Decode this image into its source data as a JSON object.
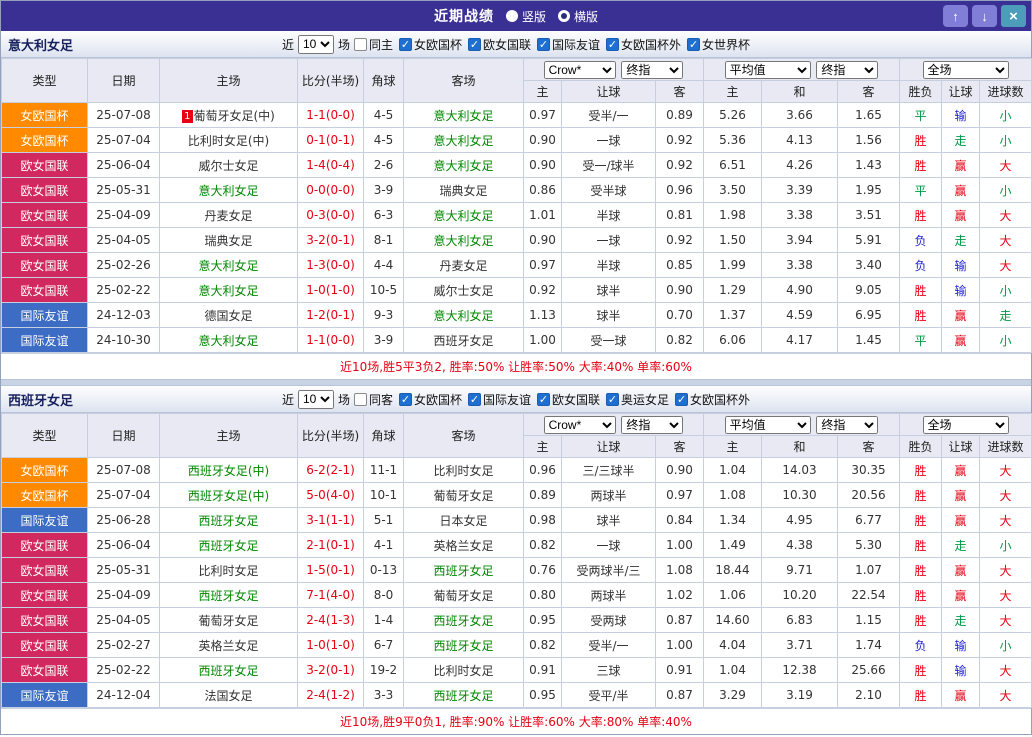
{
  "titlebar": {
    "title": "近期战绩",
    "radios": [
      {
        "label": "竖版",
        "selected": false
      },
      {
        "label": "横版",
        "selected": true
      }
    ],
    "up_icon": "↑",
    "down_icon": "↓",
    "close_icon": "×"
  },
  "colors": {
    "header_bg": "#3a3093",
    "type_orange": "#ff8a00",
    "type_pink": "#d0285f",
    "type_blue": "#3c6cc3",
    "team_green": "#008800",
    "score_red": "#e60012",
    "res_red": "#e60012",
    "res_green": "#009944",
    "res_blue": "#1f1fd0"
  },
  "columns": {
    "left": [
      "类型",
      "日期",
      "主场",
      "比分(半场)",
      "角球",
      "客场"
    ],
    "odds1": [
      "主",
      "让球",
      "客"
    ],
    "odds2": [
      "主",
      "和",
      "客"
    ],
    "result": [
      "胜负",
      "让球",
      "进球数"
    ],
    "selects": {
      "company": "Crow*",
      "final": "终指",
      "average": "平均值",
      "scope": "全场"
    }
  },
  "sections": [
    {
      "team": "意大利女足",
      "filter": {
        "prefix": "近",
        "count": "10",
        "suffix": "场",
        "checkboxes": [
          {
            "label": "同主",
            "checked": false
          },
          {
            "label": "女欧国杯",
            "checked": true
          },
          {
            "label": "欧女国联",
            "checked": true
          },
          {
            "label": "国际友谊",
            "checked": true
          },
          {
            "label": "女欧国杯外",
            "checked": true
          },
          {
            "label": "女世界杯",
            "checked": true
          }
        ]
      },
      "rows": [
        {
          "type": "女欧国杯",
          "date": "25-07-08",
          "home": "葡萄牙女足(中)",
          "home_marker": "1",
          "score": "1-1(0-0)",
          "corner": "4-5",
          "away": "意大利女足",
          "away_green": true,
          "o1": [
            "0.97",
            "受半/一",
            "0.89"
          ],
          "o2": [
            "5.26",
            "3.66",
            "1.65"
          ],
          "res": [
            [
              "平",
              "g"
            ],
            [
              "输",
              "b"
            ],
            [
              "小",
              "g"
            ]
          ]
        },
        {
          "type": "女欧国杯",
          "date": "25-07-04",
          "home": "比利时女足(中)",
          "score": "0-1(0-1)",
          "corner": "4-5",
          "away": "意大利女足",
          "away_green": true,
          "o1": [
            "0.90",
            "一球",
            "0.92"
          ],
          "o2": [
            "5.36",
            "4.13",
            "1.56"
          ],
          "res": [
            [
              "胜",
              "r"
            ],
            [
              "走",
              "g"
            ],
            [
              "小",
              "g"
            ]
          ]
        },
        {
          "type": "欧女国联",
          "date": "25-06-04",
          "home": "威尔士女足",
          "score": "1-4(0-4)",
          "corner": "2-6",
          "away": "意大利女足",
          "away_green": true,
          "o1": [
            "0.90",
            "受一/球半",
            "0.92"
          ],
          "o2": [
            "6.51",
            "4.26",
            "1.43"
          ],
          "res": [
            [
              "胜",
              "r"
            ],
            [
              "赢",
              "r"
            ],
            [
              "大",
              "r"
            ]
          ]
        },
        {
          "type": "欧女国联",
          "date": "25-05-31",
          "home": "意大利女足",
          "home_green": true,
          "score": "0-0(0-0)",
          "corner": "3-9",
          "away": "瑞典女足",
          "o1": [
            "0.86",
            "受半球",
            "0.96"
          ],
          "o2": [
            "3.50",
            "3.39",
            "1.95"
          ],
          "res": [
            [
              "平",
              "g"
            ],
            [
              "赢",
              "r"
            ],
            [
              "小",
              "g"
            ]
          ]
        },
        {
          "type": "欧女国联",
          "date": "25-04-09",
          "home": "丹麦女足",
          "score": "0-3(0-0)",
          "corner": "6-3",
          "away": "意大利女足",
          "away_green": true,
          "o1": [
            "1.01",
            "半球",
            "0.81"
          ],
          "o2": [
            "1.98",
            "3.38",
            "3.51"
          ],
          "res": [
            [
              "胜",
              "r"
            ],
            [
              "赢",
              "r"
            ],
            [
              "大",
              "r"
            ]
          ]
        },
        {
          "type": "欧女国联",
          "date": "25-04-05",
          "home": "瑞典女足",
          "score": "3-2(0-1)",
          "corner": "8-1",
          "away": "意大利女足",
          "away_green": true,
          "o1": [
            "0.90",
            "一球",
            "0.92"
          ],
          "o2": [
            "1.50",
            "3.94",
            "5.91"
          ],
          "res": [
            [
              "负",
              "b"
            ],
            [
              "走",
              "g"
            ],
            [
              "大",
              "r"
            ]
          ]
        },
        {
          "type": "欧女国联",
          "date": "25-02-26",
          "home": "意大利女足",
          "home_green": true,
          "score": "1-3(0-0)",
          "corner": "4-4",
          "away": "丹麦女足",
          "o1": [
            "0.97",
            "半球",
            "0.85"
          ],
          "o2": [
            "1.99",
            "3.38",
            "3.40"
          ],
          "res": [
            [
              "负",
              "b"
            ],
            [
              "输",
              "b"
            ],
            [
              "大",
              "r"
            ]
          ]
        },
        {
          "type": "欧女国联",
          "date": "25-02-22",
          "home": "意大利女足",
          "home_green": true,
          "score": "1-0(1-0)",
          "corner": "10-5",
          "away": "威尔士女足",
          "o1": [
            "0.92",
            "球半",
            "0.90"
          ],
          "o2": [
            "1.29",
            "4.90",
            "9.05"
          ],
          "res": [
            [
              "胜",
              "r"
            ],
            [
              "输",
              "b"
            ],
            [
              "小",
              "g"
            ]
          ]
        },
        {
          "type": "国际友谊",
          "date": "24-12-03",
          "home": "德国女足",
          "score": "1-2(0-1)",
          "corner": "9-3",
          "away": "意大利女足",
          "away_green": true,
          "o1": [
            "1.13",
            "球半",
            "0.70"
          ],
          "o2": [
            "1.37",
            "4.59",
            "6.95"
          ],
          "res": [
            [
              "胜",
              "r"
            ],
            [
              "赢",
              "r"
            ],
            [
              "走",
              "g"
            ]
          ]
        },
        {
          "type": "国际友谊",
          "date": "24-10-30",
          "home": "意大利女足",
          "home_green": true,
          "score": "1-1(0-0)",
          "corner": "3-9",
          "away": "西班牙女足",
          "o1": [
            "1.00",
            "受一球",
            "0.82"
          ],
          "o2": [
            "6.06",
            "4.17",
            "1.45"
          ],
          "res": [
            [
              "平",
              "g"
            ],
            [
              "赢",
              "r"
            ],
            [
              "小",
              "g"
            ]
          ]
        }
      ],
      "summary": "近10场,胜5平3负2, 胜率:50% 让胜率:50% 大率:40% 单率:60%"
    },
    {
      "team": "西班牙女足",
      "filter": {
        "prefix": "近",
        "count": "10",
        "suffix": "场",
        "checkboxes": [
          {
            "label": "同客",
            "checked": false
          },
          {
            "label": "女欧国杯",
            "checked": true
          },
          {
            "label": "国际友谊",
            "checked": true
          },
          {
            "label": "欧女国联",
            "checked": true
          },
          {
            "label": "奥运女足",
            "checked": true
          },
          {
            "label": "女欧国杯外",
            "checked": true
          }
        ]
      },
      "rows": [
        {
          "type": "女欧国杯",
          "date": "25-07-08",
          "home": "西班牙女足(中)",
          "home_green": true,
          "score": "6-2(2-1)",
          "corner": "11-1",
          "away": "比利时女足",
          "o1": [
            "0.96",
            "三/三球半",
            "0.90"
          ],
          "o2": [
            "1.04",
            "14.03",
            "30.35"
          ],
          "res": [
            [
              "胜",
              "r"
            ],
            [
              "赢",
              "r"
            ],
            [
              "大",
              "r"
            ]
          ]
        },
        {
          "type": "女欧国杯",
          "date": "25-07-04",
          "home": "西班牙女足(中)",
          "home_green": true,
          "score": "5-0(4-0)",
          "corner": "10-1",
          "away": "葡萄牙女足",
          "o1": [
            "0.89",
            "两球半",
            "0.97"
          ],
          "o2": [
            "1.08",
            "10.30",
            "20.56"
          ],
          "res": [
            [
              "胜",
              "r"
            ],
            [
              "赢",
              "r"
            ],
            [
              "大",
              "r"
            ]
          ]
        },
        {
          "type": "国际友谊",
          "date": "25-06-28",
          "home": "西班牙女足",
          "home_green": true,
          "score": "3-1(1-1)",
          "corner": "5-1",
          "away": "日本女足",
          "o1": [
            "0.98",
            "球半",
            "0.84"
          ],
          "o2": [
            "1.34",
            "4.95",
            "6.77"
          ],
          "res": [
            [
              "胜",
              "r"
            ],
            [
              "赢",
              "r"
            ],
            [
              "大",
              "r"
            ]
          ]
        },
        {
          "type": "欧女国联",
          "date": "25-06-04",
          "home": "西班牙女足",
          "home_green": true,
          "score": "2-1(0-1)",
          "corner": "4-1",
          "away": "英格兰女足",
          "o1": [
            "0.82",
            "一球",
            "1.00"
          ],
          "o2": [
            "1.49",
            "4.38",
            "5.30"
          ],
          "res": [
            [
              "胜",
              "r"
            ],
            [
              "走",
              "g"
            ],
            [
              "小",
              "g"
            ]
          ]
        },
        {
          "type": "欧女国联",
          "date": "25-05-31",
          "home": "比利时女足",
          "score": "1-5(0-1)",
          "corner": "0-13",
          "away": "西班牙女足",
          "away_green": true,
          "o1": [
            "0.76",
            "受两球半/三",
            "1.08"
          ],
          "o2": [
            "18.44",
            "9.71",
            "1.07"
          ],
          "res": [
            [
              "胜",
              "r"
            ],
            [
              "赢",
              "r"
            ],
            [
              "大",
              "r"
            ]
          ]
        },
        {
          "type": "欧女国联",
          "date": "25-04-09",
          "home": "西班牙女足",
          "home_green": true,
          "score": "7-1(4-0)",
          "corner": "8-0",
          "away": "葡萄牙女足",
          "o1": [
            "0.80",
            "两球半",
            "1.02"
          ],
          "o2": [
            "1.06",
            "10.20",
            "22.54"
          ],
          "res": [
            [
              "胜",
              "r"
            ],
            [
              "赢",
              "r"
            ],
            [
              "大",
              "r"
            ]
          ]
        },
        {
          "type": "欧女国联",
          "date": "25-04-05",
          "home": "葡萄牙女足",
          "score": "2-4(1-3)",
          "corner": "1-4",
          "away": "西班牙女足",
          "away_green": true,
          "o1": [
            "0.95",
            "受两球",
            "0.87"
          ],
          "o2": [
            "14.60",
            "6.83",
            "1.15"
          ],
          "res": [
            [
              "胜",
              "r"
            ],
            [
              "走",
              "g"
            ],
            [
              "大",
              "r"
            ]
          ]
        },
        {
          "type": "欧女国联",
          "date": "25-02-27",
          "home": "英格兰女足",
          "score": "1-0(1-0)",
          "corner": "6-7",
          "away": "西班牙女足",
          "away_green": true,
          "o1": [
            "0.82",
            "受半/一",
            "1.00"
          ],
          "o2": [
            "4.04",
            "3.71",
            "1.74"
          ],
          "res": [
            [
              "负",
              "b"
            ],
            [
              "输",
              "b"
            ],
            [
              "小",
              "g"
            ]
          ]
        },
        {
          "type": "欧女国联",
          "date": "25-02-22",
          "home": "西班牙女足",
          "home_green": true,
          "score": "3-2(0-1)",
          "corner": "19-2",
          "away": "比利时女足",
          "o1": [
            "0.91",
            "三球",
            "0.91"
          ],
          "o2": [
            "1.04",
            "12.38",
            "25.66"
          ],
          "res": [
            [
              "胜",
              "r"
            ],
            [
              "输",
              "b"
            ],
            [
              "大",
              "r"
            ]
          ]
        },
        {
          "type": "国际友谊",
          "date": "24-12-04",
          "home": "法国女足",
          "score": "2-4(1-2)",
          "corner": "3-3",
          "away": "西班牙女足",
          "away_green": true,
          "o1": [
            "0.95",
            "受平/半",
            "0.87"
          ],
          "o2": [
            "3.29",
            "3.19",
            "2.10"
          ],
          "res": [
            [
              "胜",
              "r"
            ],
            [
              "赢",
              "r"
            ],
            [
              "大",
              "r"
            ]
          ]
        }
      ],
      "summary": "近10场,胜9平0负1, 胜率:90% 让胜率:60% 大率:80% 单率:40%"
    }
  ]
}
